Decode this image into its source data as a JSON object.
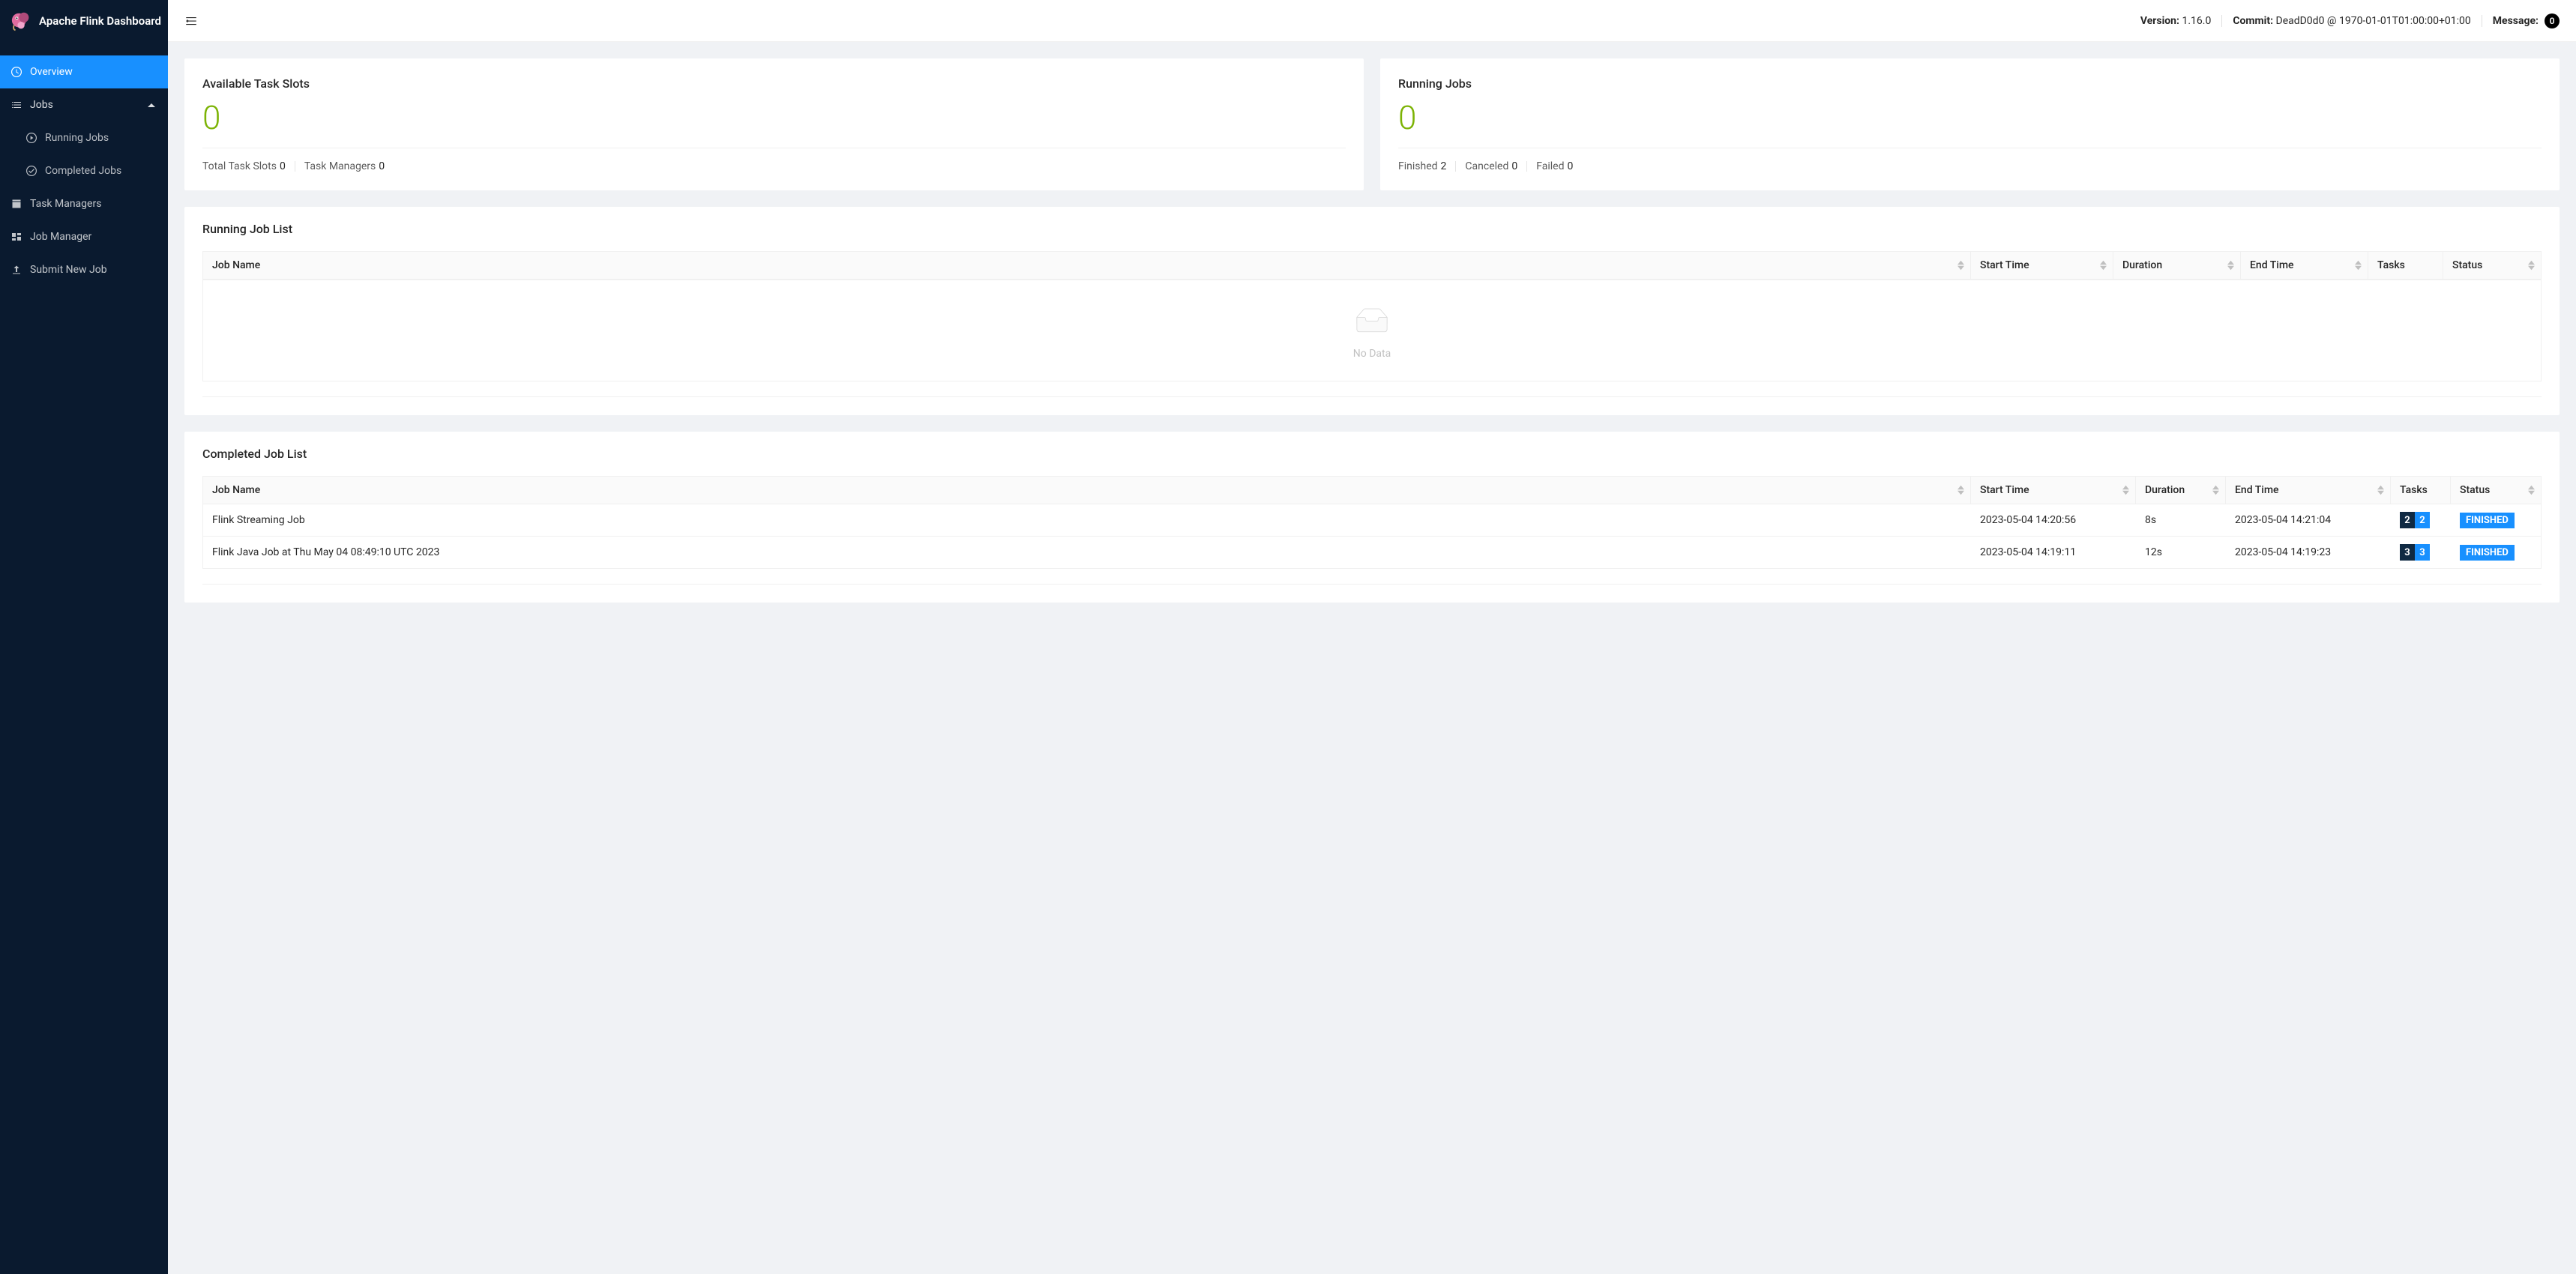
{
  "app_title": "Apache Flink Dashboard",
  "header": {
    "version_label": "Version:",
    "version_value": "1.16.0",
    "commit_label": "Commit:",
    "commit_value": "DeadD0d0 @ 1970-01-01T01:00:00+01:00",
    "message_label": "Message:",
    "message_count": "0"
  },
  "sidebar": {
    "overview": "Overview",
    "jobs": "Jobs",
    "jobs_running": "Running Jobs",
    "jobs_completed": "Completed Jobs",
    "task_managers": "Task Managers",
    "job_manager": "Job Manager",
    "submit_new_job": "Submit New Job"
  },
  "cards": {
    "slots": {
      "title": "Available Task Slots",
      "value": "0",
      "total_label": "Total Task Slots",
      "total_value": "0",
      "managers_label": "Task Managers",
      "managers_value": "0"
    },
    "running": {
      "title": "Running Jobs",
      "value": "0",
      "finished_label": "Finished",
      "finished_value": "2",
      "canceled_label": "Canceled",
      "canceled_value": "0",
      "failed_label": "Failed",
      "failed_value": "0"
    }
  },
  "running_list": {
    "title": "Running Job List",
    "columns": {
      "name": "Job Name",
      "start": "Start Time",
      "duration": "Duration",
      "end": "End Time",
      "tasks": "Tasks",
      "status": "Status"
    },
    "empty": "No Data"
  },
  "completed_list": {
    "title": "Completed Job List",
    "columns": {
      "name": "Job Name",
      "start": "Start Time",
      "duration": "Duration",
      "end": "End Time",
      "tasks": "Tasks",
      "status": "Status"
    },
    "rows": [
      {
        "name": "Flink Streaming Job",
        "start": "2023-05-04 14:20:56",
        "duration": "8s",
        "end": "2023-05-04 14:21:04",
        "tasks_a": "2",
        "tasks_b": "2",
        "status": "FINISHED"
      },
      {
        "name": "Flink Java Job at Thu May 04 08:49:10 UTC 2023",
        "start": "2023-05-04 14:19:11",
        "duration": "12s",
        "end": "2023-05-04 14:19:23",
        "tasks_a": "3",
        "tasks_b": "3",
        "status": "FINISHED"
      }
    ]
  }
}
